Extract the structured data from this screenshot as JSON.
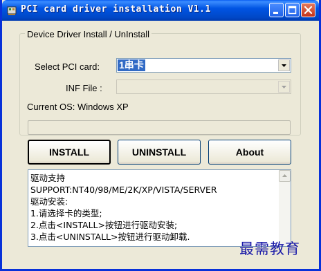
{
  "window": {
    "title": "PCI card driver installation V1.1",
    "title_bar_color": "#0054e3",
    "controls": [
      "minimize-icon",
      "maximize-icon",
      "close-icon"
    ]
  },
  "group": {
    "title": "Device Driver Install / UnInstall"
  },
  "pci_card": {
    "label": "Select PCI card:",
    "selected": "1串卡"
  },
  "inf_file": {
    "label": "INF File :",
    "value": ""
  },
  "current_os": {
    "label": "Current OS:",
    "value": "Windows XP"
  },
  "progress": {
    "value": 0
  },
  "buttons": {
    "install": "INSTALL",
    "uninstall": "UNINSTALL",
    "about": "About"
  },
  "info": {
    "lines": [
      "驱动支持",
      "SUPPORT:NT40/98/ME/2K/XP/VISTA/SERVER",
      "驱动安装:",
      "1.请选择卡的类型;",
      "2.点击<INSTALL>按钮进行驱动安装;",
      "3.点击<UNINSTALL>按钮进行驱动卸载."
    ]
  },
  "watermark": "最需教育",
  "colors": {
    "selection": "#316ac5",
    "watermark": "#1a1aa8",
    "window_face": "#ece9d8"
  }
}
